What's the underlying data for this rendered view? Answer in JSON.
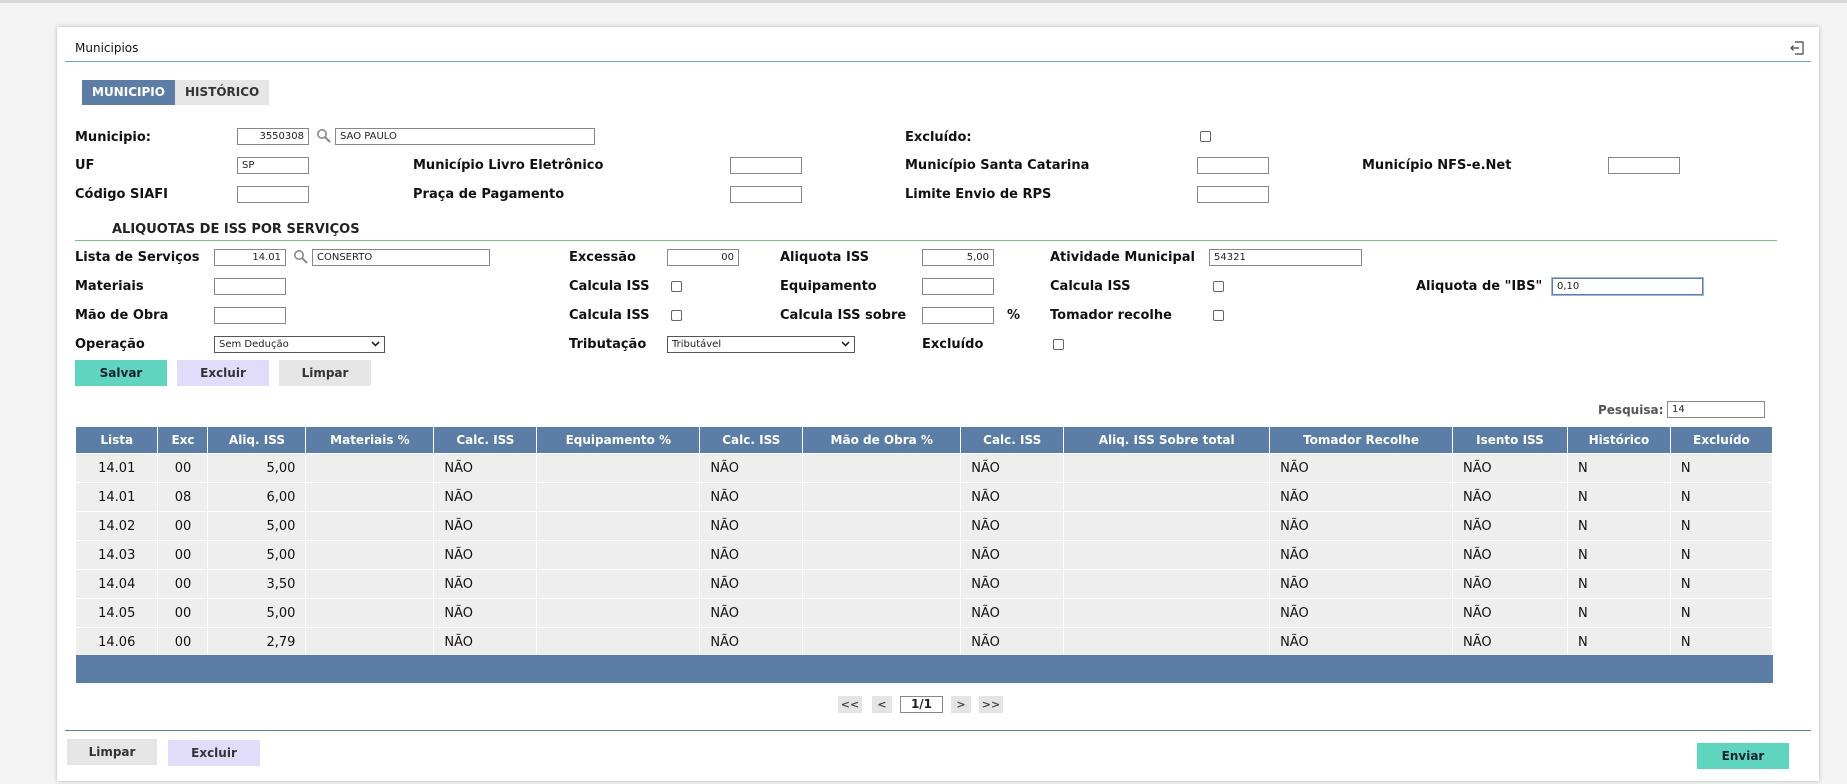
{
  "window": {
    "title": "Municipios"
  },
  "tabs": [
    {
      "label": "MUNICIPIO"
    },
    {
      "label": "HISTÓRICO"
    }
  ],
  "municipio": {
    "municipio_label": "Municipio:",
    "municipio_code": "3550308",
    "municipio_name": "SAO PAULO",
    "excluido_label": "Excluído:",
    "uf_label": "UF",
    "uf_value": "SP",
    "livro_label": "Município Livro Eletrônico",
    "santa_catarina_label": "Município Santa Catarina",
    "nfse_label": "Município NFS-e.Net",
    "siafi_label": "Código SIAFI",
    "praca_label": "Praça de Pagamento",
    "limite_label": "Limite Envio de RPS"
  },
  "aliquotas": {
    "section_title": "ALIQUOTAS DE ISS POR SERVIÇOS",
    "lista_label": "Lista de Serviços",
    "lista_code": "14.01",
    "lista_name": "CONSERTO",
    "excessao_label": "Excessão",
    "excessao_value": "00",
    "aliquota_iss_label": "Aliquota ISS",
    "aliquota_iss_value": "5,00",
    "atividade_label": "Atividade Municipal",
    "atividade_value": "54321",
    "materiais_label": "Materiais",
    "calcula_iss_label": "Calcula ISS",
    "equipamento_label": "Equipamento",
    "aliquota_ibs_label": "Aliquota de \"IBS\"",
    "aliquota_ibs_value": "0,10",
    "mao_obra_label": "Mão de Obra",
    "calcula_iss_sobre_label": "Calcula ISS sobre",
    "percent": "%",
    "tomador_label": "Tomador recolhe",
    "operacao_label": "Operação",
    "operacao_value": "Sem Dedução",
    "tributacao_label": "Tributação",
    "tributacao_value": "Tributável",
    "excluido_label": "Excluído"
  },
  "actions": {
    "salvar": "Salvar",
    "excluir": "Excluir",
    "limpar": "Limpar"
  },
  "search": {
    "label": "Pesquisa:",
    "value": "14"
  },
  "table": {
    "headers": [
      "Lista",
      "Exc",
      "Aliq. ISS",
      "Materiais %",
      "Calc. ISS",
      "Equipamento %",
      "Calc. ISS",
      "Mão de Obra %",
      "Calc. ISS",
      "Aliq. ISS Sobre total",
      "Tomador Recolhe",
      "Isento ISS",
      "Histórico",
      "Excluído"
    ],
    "rows": [
      [
        "14.01",
        "00",
        "5,00",
        "",
        "NÃO",
        "",
        "NÃO",
        "",
        "NÃO",
        "",
        "NÃO",
        "NÃO",
        "N",
        "N"
      ],
      [
        "14.01",
        "08",
        "6,00",
        "",
        "NÃO",
        "",
        "NÃO",
        "",
        "NÃO",
        "",
        "NÃO",
        "NÃO",
        "N",
        "N"
      ],
      [
        "14.02",
        "00",
        "5,00",
        "",
        "NÃO",
        "",
        "NÃO",
        "",
        "NÃO",
        "",
        "NÃO",
        "NÃO",
        "N",
        "N"
      ],
      [
        "14.03",
        "00",
        "5,00",
        "",
        "NÃO",
        "",
        "NÃO",
        "",
        "NÃO",
        "",
        "NÃO",
        "NÃO",
        "N",
        "N"
      ],
      [
        "14.04",
        "00",
        "3,50",
        "",
        "NÃO",
        "",
        "NÃO",
        "",
        "NÃO",
        "",
        "NÃO",
        "NÃO",
        "N",
        "N"
      ],
      [
        "14.05",
        "00",
        "5,00",
        "",
        "NÃO",
        "",
        "NÃO",
        "",
        "NÃO",
        "",
        "NÃO",
        "NÃO",
        "N",
        "N"
      ],
      [
        "14.06",
        "00",
        "2,79",
        "",
        "NÃO",
        "",
        "NÃO",
        "",
        "NÃO",
        "",
        "NÃO",
        "NÃO",
        "N",
        "N"
      ]
    ]
  },
  "pagination": {
    "first": "<<",
    "prev": "<",
    "page": "1/1",
    "next": ">",
    "last": ">>"
  },
  "footer": {
    "limpar": "Limpar",
    "excluir": "Excluir",
    "enviar": "Enviar"
  },
  "colors": {
    "header_blue": "#5b7da6",
    "accent_green": "#5fd4bf",
    "soft_purple": "#e0dcfa"
  }
}
